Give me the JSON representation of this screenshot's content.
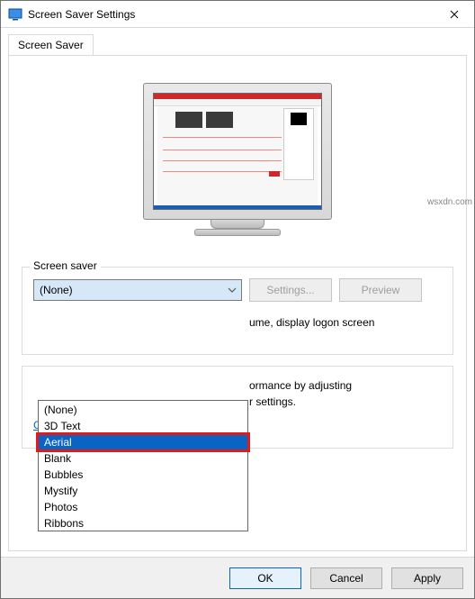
{
  "window": {
    "title": "Screen Saver Settings"
  },
  "tab": {
    "label": "Screen Saver"
  },
  "group_screensaver": {
    "legend": "Screen saver",
    "selected": "(None)",
    "settings_button": "Settings...",
    "preview_button": "Preview",
    "resume_text": "ume, display logon screen"
  },
  "dropdown": {
    "options": [
      "(None)",
      "3D Text",
      "Aerial",
      "Blank",
      "Bubbles",
      "Mystify",
      "Photos",
      "Ribbons"
    ],
    "highlighted_index": 2
  },
  "group_power": {
    "text_line1_right": "ormance by adjusting",
    "text_line2_right": "r settings.",
    "link_visible": "Change power settings"
  },
  "footer": {
    "ok": "OK",
    "cancel": "Cancel",
    "apply": "Apply"
  },
  "watermark": "wsxdn.com"
}
